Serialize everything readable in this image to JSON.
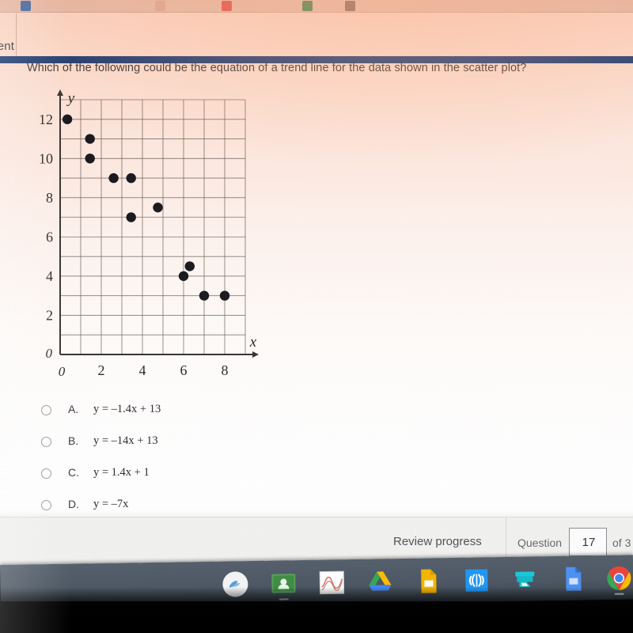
{
  "browser": {
    "tabs": [
      {
        "name": "tab-favicon-1",
        "color": "#2f6fd0"
      },
      {
        "name": "tab-favicon-2",
        "color": "#d9c2bb"
      },
      {
        "name": "tab-favicon-3",
        "color": "#e04b4b"
      },
      {
        "name": "tab-favicon-4",
        "color": "#2f8f4e"
      },
      {
        "name": "tab-favicon-5",
        "color": "#6a5d58"
      }
    ]
  },
  "header": {
    "partial_title": "ment"
  },
  "question": {
    "prompt": "Which of the following could be the equation of a trend line for the data shown in the scatter plot?",
    "choices": [
      {
        "letter": "A.",
        "equation": "y = –1.4x + 13"
      },
      {
        "letter": "B.",
        "equation": "y = –14x + 13"
      },
      {
        "letter": "C.",
        "equation": "y = 1.4x + 1"
      },
      {
        "letter": "D.",
        "equation": "y = –7x"
      }
    ]
  },
  "chart_data": {
    "type": "scatter",
    "title": "",
    "xlabel": "x",
    "ylabel": "y",
    "xlim": [
      0,
      9
    ],
    "ylim": [
      0,
      13
    ],
    "grid": true,
    "grid_step": 1,
    "xticks": [
      0,
      2,
      4,
      6,
      8
    ],
    "yticks": [
      0,
      2,
      4,
      6,
      8,
      10,
      12
    ],
    "origin_label": "0",
    "legend": "none",
    "points": [
      {
        "x": 0.35,
        "y": 12.0
      },
      {
        "x": 1.45,
        "y": 11.0
      },
      {
        "x": 1.45,
        "y": 10.0
      },
      {
        "x": 2.6,
        "y": 9.0
      },
      {
        "x": 3.45,
        "y": 9.0
      },
      {
        "x": 3.45,
        "y": 7.0
      },
      {
        "x": 4.75,
        "y": 7.5
      },
      {
        "x": 6.0,
        "y": 4.0
      },
      {
        "x": 6.3,
        "y": 4.5
      },
      {
        "x": 7.0,
        "y": 3.0
      },
      {
        "x": 8.0,
        "y": 3.0
      }
    ]
  },
  "footer": {
    "review_progress_label": "Review progress",
    "question_label": "Question",
    "question_number": "17",
    "question_total": "of 3"
  },
  "shelf": {
    "items": [
      {
        "name": "launcher-icon",
        "label": "Launcher"
      },
      {
        "name": "google-classroom-icon",
        "label": "Google Classroom"
      },
      {
        "name": "graphing-calculator-icon",
        "label": "Graphing Calculator"
      },
      {
        "name": "google-drive-icon",
        "label": "Google Drive"
      },
      {
        "name": "google-slides-icon",
        "label": "Google Slides"
      },
      {
        "name": "audio-wave-icon",
        "label": "Audio"
      },
      {
        "name": "scanner-icon",
        "label": "Scanner"
      },
      {
        "name": "google-docs-icon",
        "label": "Google Docs"
      },
      {
        "name": "chrome-icon",
        "label": "Chrome"
      }
    ]
  },
  "colors": {
    "blue_bar": "#19418c",
    "glare_pink": "#f8b496",
    "shelf": "#4d5864",
    "point": "#1c1c22"
  }
}
